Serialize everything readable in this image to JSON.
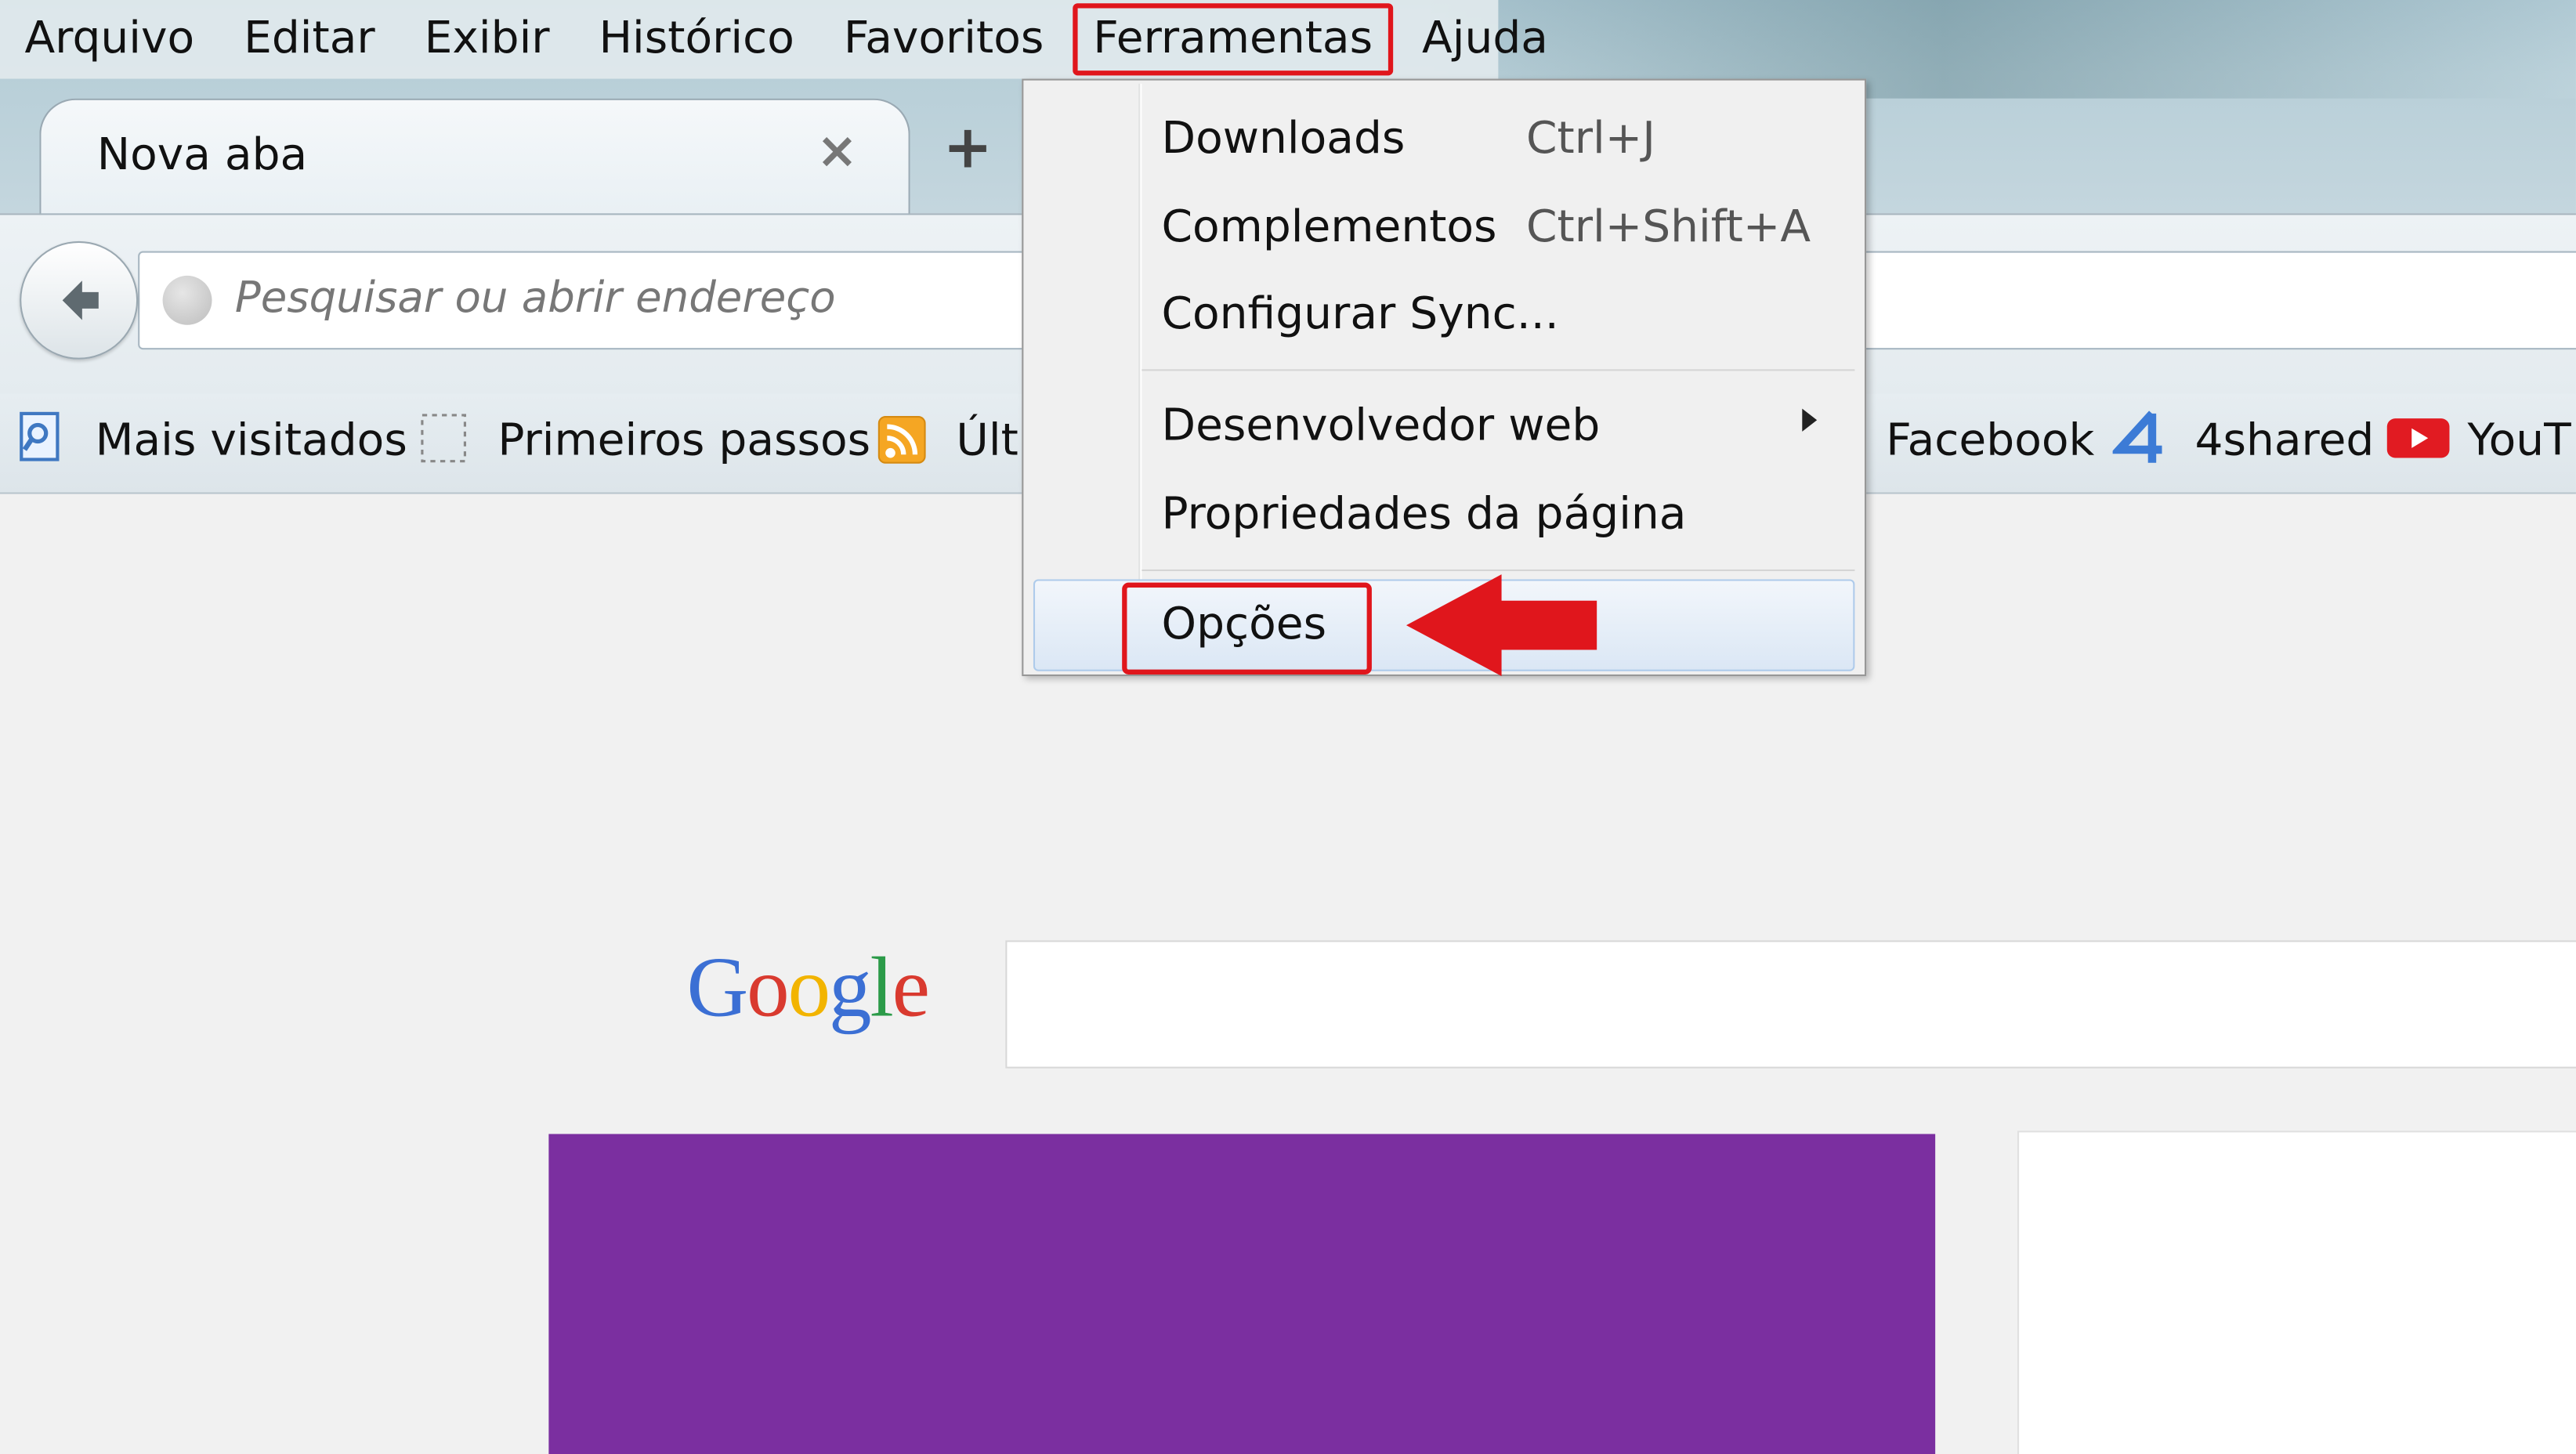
{
  "menubar": {
    "items": [
      {
        "label": "Arquivo"
      },
      {
        "label": "Editar"
      },
      {
        "label": "Exibir"
      },
      {
        "label": "Histórico"
      },
      {
        "label": "Favoritos"
      },
      {
        "label": "Ferramentas"
      },
      {
        "label": "Ajuda"
      }
    ]
  },
  "tab": {
    "title": "Nova aba",
    "close": "×",
    "new_tab": "+"
  },
  "navbar": {
    "placeholder": "Pesquisar ou abrir endereço"
  },
  "bookmarks": {
    "items": [
      {
        "label": "Mais visitados"
      },
      {
        "label": "Primeiros passos"
      },
      {
        "label": "Últ"
      },
      {
        "label": "Facebook"
      },
      {
        "label": "4shared"
      },
      {
        "label": "YouT"
      }
    ]
  },
  "tools_menu": {
    "downloads": {
      "label": "Downloads",
      "shortcut": "Ctrl+J"
    },
    "addons": {
      "label": "Complementos",
      "shortcut": "Ctrl+Shift+A"
    },
    "sync": {
      "label": "Configurar Sync..."
    },
    "webdev": {
      "label": "Desenvolvedor web"
    },
    "page_info": {
      "label": "Propriedades da página"
    },
    "options": {
      "label": "Opções"
    }
  },
  "content": {
    "google_logo": "Google"
  },
  "colors": {
    "highlight": "#e0161c",
    "tile": "#7b2fa0"
  }
}
